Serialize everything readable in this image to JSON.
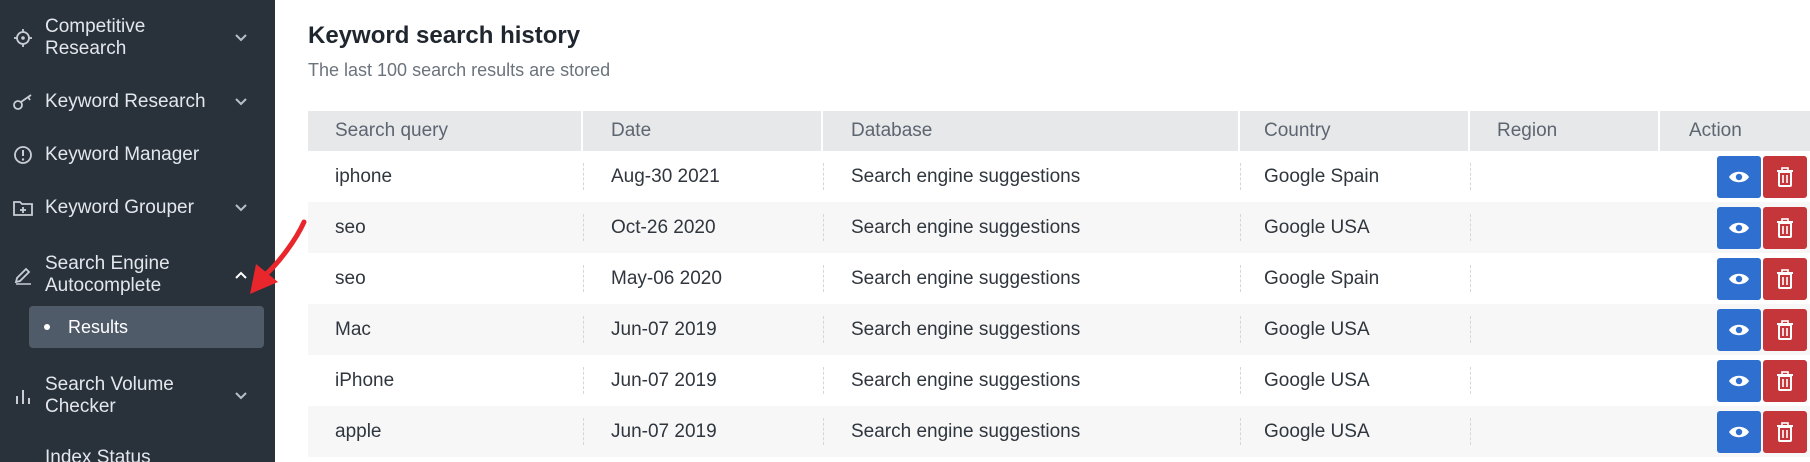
{
  "sidebar": {
    "items": [
      {
        "label": "Competitive Research",
        "icon": "target-icon",
        "chevron": "down"
      },
      {
        "label": "Keyword Research",
        "icon": "key-icon",
        "chevron": "down"
      },
      {
        "label": "Keyword Manager",
        "icon": "info-circle-icon",
        "chevron": "none"
      },
      {
        "label": "Keyword Grouper",
        "icon": "folder-plus-icon",
        "chevron": "down"
      },
      {
        "label": "Search Engine Autocomplete",
        "icon": "pencil-icon",
        "chevron": "up"
      },
      {
        "label": "Search Volume Checker",
        "icon": "bar-chart-icon",
        "chevron": "down"
      },
      {
        "label": "Index Status",
        "icon": "none",
        "chevron": "none"
      }
    ],
    "active_subitem": {
      "label": "Results"
    }
  },
  "main": {
    "title": "Keyword search history",
    "subtitle": "The last 100 search results are stored",
    "table": {
      "headers": {
        "query": "Search query",
        "date": "Date",
        "database": "Database",
        "country": "Country",
        "region": "Region",
        "action": "Action"
      },
      "rows": [
        {
          "query": "iphone",
          "date": "Aug-30 2021",
          "database": "Search engine suggestions",
          "country": "Google Spain",
          "region": ""
        },
        {
          "query": "seo",
          "date": "Oct-26 2020",
          "database": "Search engine suggestions",
          "country": "Google USA",
          "region": ""
        },
        {
          "query": "seo",
          "date": "May-06 2020",
          "database": "Search engine suggestions",
          "country": "Google Spain",
          "region": ""
        },
        {
          "query": "Mac",
          "date": "Jun-07 2019",
          "database": "Search engine suggestions",
          "country": "Google USA",
          "region": ""
        },
        {
          "query": "iPhone",
          "date": "Jun-07 2019",
          "database": "Search engine suggestions",
          "country": "Google USA",
          "region": ""
        },
        {
          "query": "apple",
          "date": "Jun-07 2019",
          "database": "Search engine suggestions",
          "country": "Google USA",
          "region": ""
        }
      ]
    }
  },
  "colors": {
    "sidebar_bg": "#29313b",
    "active_item_bg": "#4f5b68",
    "view_button": "#2f6fd0",
    "delete_button": "#c4363a",
    "annotation_arrow": "#e8262b"
  }
}
